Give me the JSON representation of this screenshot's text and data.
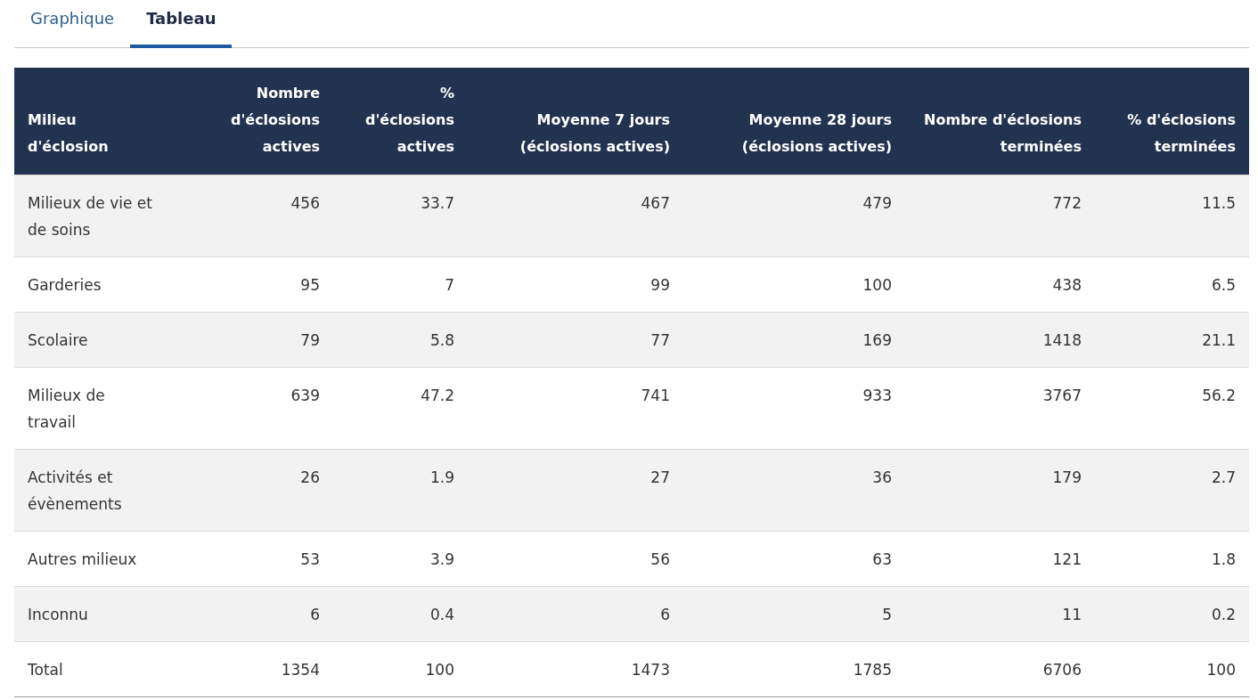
{
  "tabs": [
    {
      "label": "Graphique",
      "selected": false
    },
    {
      "label": "Tableau",
      "selected": true
    }
  ],
  "table": {
    "columns": [
      "Milieu d'éclosion",
      "Nombre d'éclosions actives",
      "% d'éclosions actives",
      "Moyenne 7 jours (éclosions actives)",
      "Moyenne 28 jours (éclosions actives)",
      "Nombre d'éclosions terminées",
      "% d'éclosions terminées"
    ],
    "rows": [
      [
        "Milieux de vie et de soins",
        "456",
        "33.7",
        "467",
        "479",
        "772",
        "11.5"
      ],
      [
        "Garderies",
        "95",
        "7",
        "99",
        "100",
        "438",
        "6.5"
      ],
      [
        "Scolaire",
        "79",
        "5.8",
        "77",
        "169",
        "1418",
        "21.1"
      ],
      [
        "Milieux de travail",
        "639",
        "47.2",
        "741",
        "933",
        "3767",
        "56.2"
      ],
      [
        "Activités et évènements",
        "26",
        "1.9",
        "27",
        "36",
        "179",
        "2.7"
      ],
      [
        "Autres milieux",
        "53",
        "3.9",
        "56",
        "63",
        "121",
        "1.8"
      ],
      [
        "Inconnu",
        "6",
        "0.4",
        "6",
        "5",
        "11",
        "0.2"
      ],
      [
        "Total",
        "1354",
        "100",
        "1473",
        "1785",
        "6706",
        "100"
      ]
    ]
  }
}
